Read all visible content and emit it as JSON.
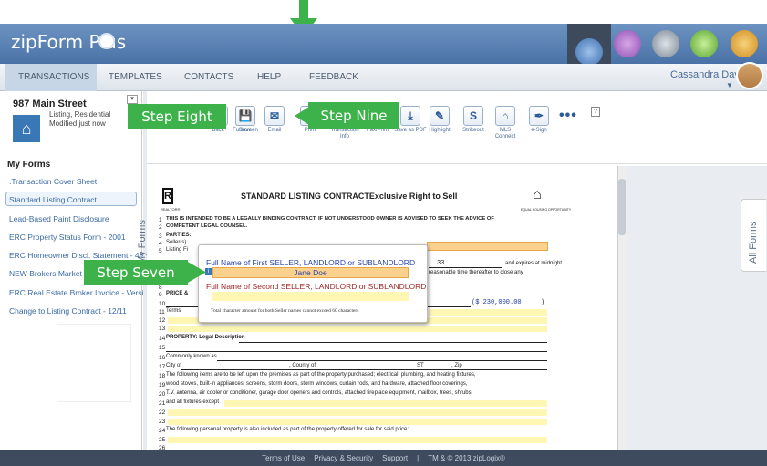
{
  "app": {
    "logo": "zipForm Plus"
  },
  "nav": {
    "tabs": [
      "TRANSACTIONS",
      "TEMPLATES",
      "CONTACTS",
      "HELP",
      "FEEDBACK"
    ],
    "user": "Cassandra Davis"
  },
  "sidebar": {
    "property": "987 Main Street",
    "property_type": "Listing, Residential",
    "modified": "Modified just now",
    "my_forms_heading": "My Forms",
    "forms": [
      ".Transaction Cover Sheet",
      "Standard Listing Contract",
      "Lead-Based Paint Disclosure",
      "ERC Property Status Form - 2001",
      "ERC Homeowner Discl. Statement - 4/92",
      "NEW Brokers Market Ana",
      "ERC Real Estate Broker Invoice - Version",
      "Change to Listing Contract - 12/11"
    ],
    "my_forms_tab": "My Forms"
  },
  "toolbar": {
    "tools": [
      "Back",
      "Fullscreen",
      "Save",
      "Email",
      "Print",
      "Transaction Info",
      "Fax/Print",
      "Save as PDF",
      "Highlight",
      "Strikeout",
      "MLS Connect",
      "e-Sign"
    ],
    "more": "•••",
    "help": "?"
  },
  "steps": {
    "eight": "Step Eight",
    "nine": "Step Nine",
    "seven": "Step Seven"
  },
  "document": {
    "title": "STANDARD LISTING CONTRACT",
    "title_suffix": "Exclusive Right to Sell",
    "realtor_mark": "R",
    "realtor_caption": "REALTOR®",
    "eho_caption": "EQUAL HOUSING OPPORTUNITY",
    "line1": "THIS IS INTENDED TO BE A LEGALLY BINDING CONTRACT. IF NOT UNDERSTOOD OWNER IS ADVISED TO SEEK THE ADVICE OF",
    "line2": "COMPETENT LEGAL COUNSEL.",
    "parties": "PARTIES:",
    "seller": "Seller(s)",
    "listing": "Listing Fi",
    "date_value": "33",
    "expires": "and expires at midnight",
    "close": "reasonable time thereafter to close any",
    "price": "PRICE &",
    "price_value": "($ 230,000.00",
    "price_close": ")",
    "terms": "Terms",
    "property": "PROPERTY: Legal Description",
    "commonly": "Commonly known as",
    "city": "City of",
    "county": ", County of",
    "st": "ST",
    "zip": ", Zip",
    "line18": "The following items are to be left upon the premises as part of the property purchased; electrical, plumbing, and heating fixtures,",
    "line19": "wood stoves, built-in appliances, screens, storm doors, storm windows, curtain rods, and hardware, attached floor coverings,",
    "line20": "T.V. antenna, air cooler or conditioner, garage door openers and controls, attached fireplace equipment, mailbox, trees, shrubs,",
    "line21": "and all fixtures except",
    "line24": "The following personal property is also included as part of the property offered for sale for said price:",
    "line_numbers": [
      "1",
      "2",
      "3",
      "4",
      "5",
      "6",
      "7",
      "8",
      "9",
      "10",
      "11",
      "12",
      "13",
      "14",
      "15",
      "16",
      "17",
      "18",
      "19",
      "20",
      "21",
      "22",
      "23",
      "24",
      "25",
      "26"
    ]
  },
  "popup": {
    "label1": "Full Name of First SELLER, LANDLORD or SUBLANDLORD",
    "value1": "Jane Doe",
    "label2": "Full Name of Second SELLER, LANDLORD or SUBLANDLORD",
    "note": "Total character amount for both Seller names cannot exceed 60 characters"
  },
  "right_panel": {
    "all_forms_tab": "All Forms"
  },
  "footer": {
    "items": [
      "Terms of Use",
      "Privacy & Security",
      "Support",
      "|",
      "TM & © 2013 zipLogix®"
    ]
  },
  "colors": {
    "header": "#5a81b3",
    "step_green": "#3db24a",
    "nav_active": "#c7d6e6",
    "footer": "#3e4b5e"
  }
}
